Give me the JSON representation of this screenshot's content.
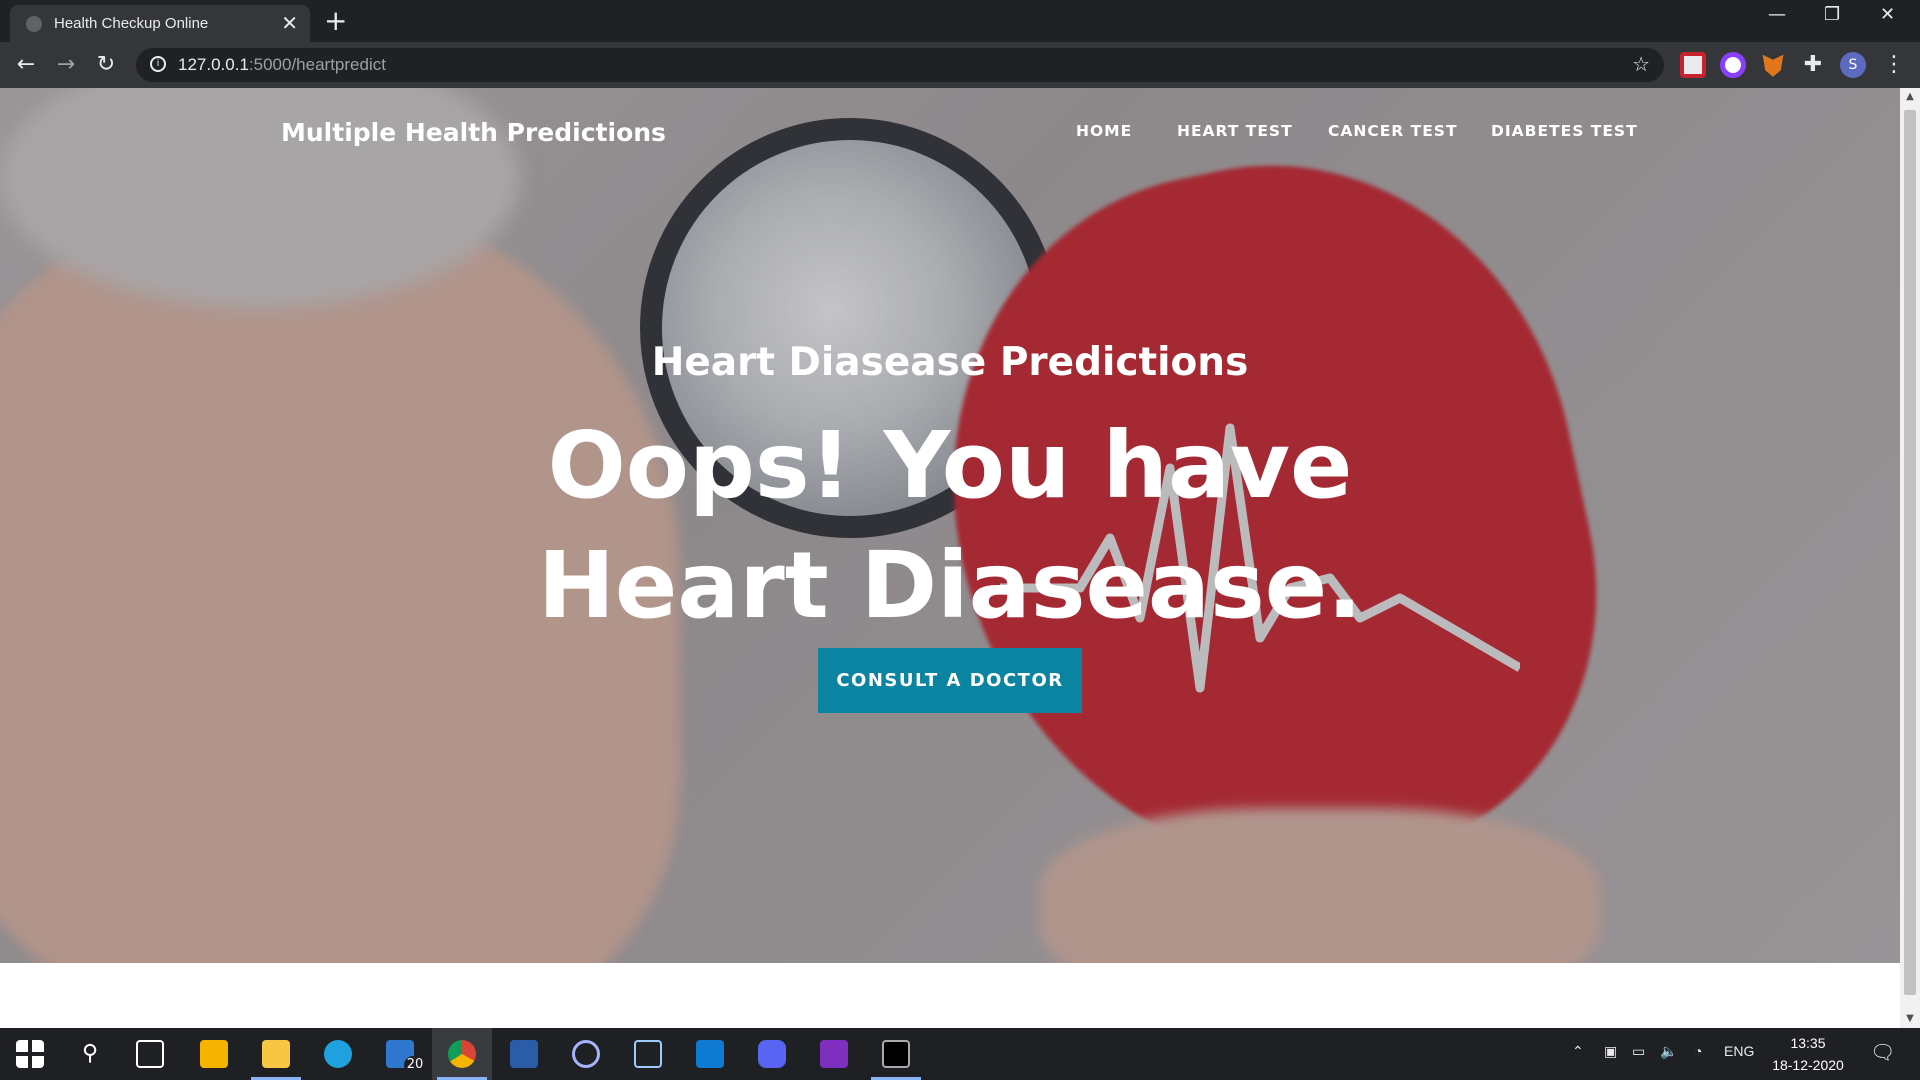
{
  "browser": {
    "tab_title": "Health Checkup Online",
    "new_tab": "+",
    "url_host": "127.0.0.1",
    "url_path": ":5000/heartpredict",
    "window_controls": [
      "—",
      "❐",
      "✕"
    ]
  },
  "site": {
    "brand": "Multiple Health Predictions",
    "nav": [
      "HOME",
      "HEART TEST",
      "CANCER TEST",
      "DIABETES TEST"
    ]
  },
  "hero": {
    "subtitle": "Heart Diasease Predictions",
    "headline_line1": "Oops! You have",
    "headline_line2": "Heart Diasease.",
    "cta": "CONSULT A DOCTOR"
  },
  "taskbar": {
    "mail_badge": "20",
    "language": "ENG",
    "time": "13:35",
    "date": "18-12-2020"
  },
  "colors": {
    "cta_bg": "#0b84a1",
    "heart_red": "#c8232c",
    "browser_dark": "#202124"
  }
}
